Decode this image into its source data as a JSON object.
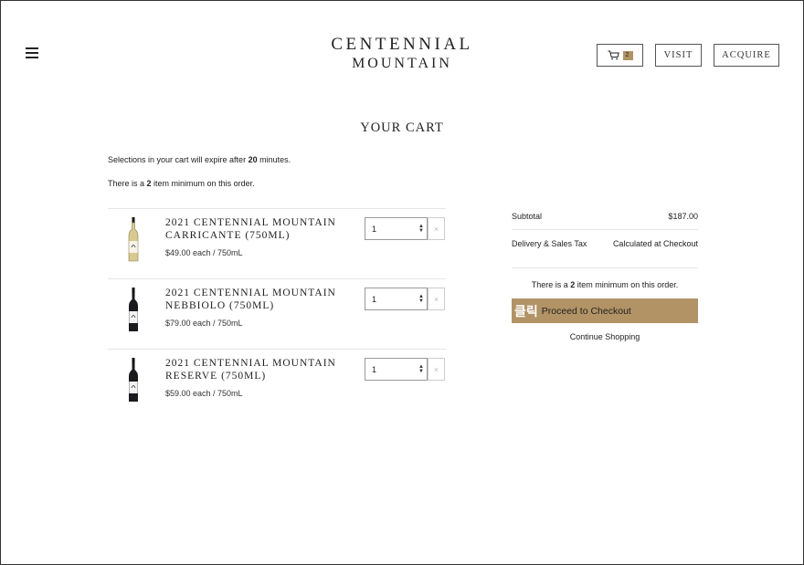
{
  "header": {
    "logo_line1": "CENTENNIAL",
    "logo_line2": "MOUNTAIN",
    "cart_count": "2",
    "visit_label": "VISIT",
    "acquire_label": "ACQUIRE"
  },
  "page": {
    "title": "YOUR CART",
    "expire_prefix": "Selections in your cart will expire after ",
    "expire_minutes": "20",
    "expire_suffix": " minutes.",
    "minimum_prefix": "There is a ",
    "minimum_count": "2",
    "minimum_suffix": " item minimum on this order."
  },
  "items": [
    {
      "name": "2021 CENTENNIAL MOUNTAIN CARRICANTE (750ML)",
      "price": "$49.00 each / 750mL",
      "quantity": "1",
      "remove": "×",
      "bottle": "white"
    },
    {
      "name": "2021 CENTENNIAL MOUNTAIN NEBBIOLO (750ML)",
      "price": "$79.00 each / 750mL",
      "quantity": "1",
      "remove": "×",
      "bottle": "red"
    },
    {
      "name": "2021 CENTENNIAL MOUNTAIN RESERVE (750ML)",
      "price": "$59.00 each / 750mL",
      "quantity": "1",
      "remove": "×",
      "bottle": "red"
    }
  ],
  "summary": {
    "subtotal_label": "Subtotal",
    "subtotal_value": "$187.00",
    "tax_label": "Delivery & Sales Tax",
    "tax_value": "Calculated at Checkout",
    "minimum_prefix": "There is a ",
    "minimum_count": "2",
    "minimum_suffix": " item minimum on this order.",
    "click_tag": "클릭",
    "checkout_label": "Proceed to Checkout",
    "continue_label": "Continue Shopping"
  },
  "colors": {
    "accent": "#b29366",
    "text": "#222222"
  },
  "icons": {
    "menu": "hamburger-icon",
    "cart": "cart-icon",
    "quantity_arrows": "chevron-up-down-icon",
    "remove": "close-icon"
  }
}
